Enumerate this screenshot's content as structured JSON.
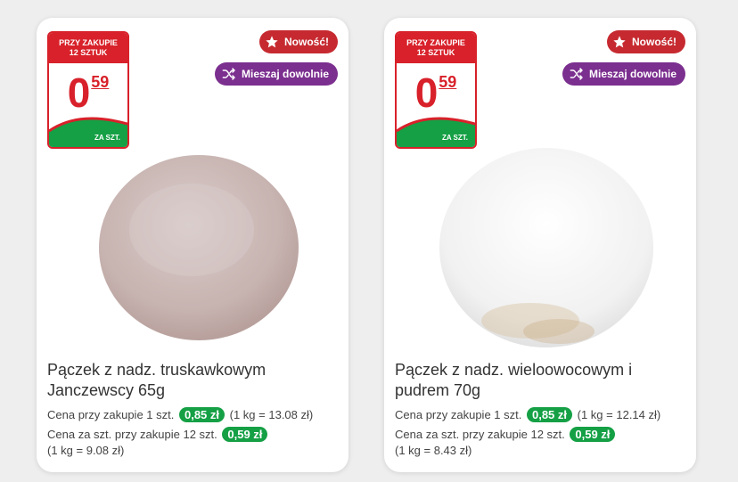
{
  "products": [
    {
      "badge": {
        "line1": "PRZY ZAKUPIE",
        "line2": "12 SZTUK",
        "price_int": "0",
        "price_dec": "59",
        "unit": "ZA SZT."
      },
      "new_label": "Nowość!",
      "mix_label": "Mieszaj dowolnie",
      "title_line1": "Pączek z nadz. truskawkowym",
      "title_line2": "Janczewscy 65g",
      "single_label": "Cena przy zakupie 1 szt.",
      "single_price": "0,85 zł",
      "single_per_kg": "(1 kg = 13.08 zł)",
      "bulk_label": "Cena za szt. przy zakupie 12 szt.",
      "bulk_price": "0,59 zł",
      "bulk_per_kg": "(1 kg = 9.08 zł)",
      "image_icon": "donut-powdered-pink"
    },
    {
      "badge": {
        "line1": "PRZY ZAKUPIE",
        "line2": "12 SZTUK",
        "price_int": "0",
        "price_dec": "59",
        "unit": "ZA SZT."
      },
      "new_label": "Nowość!",
      "mix_label": "Mieszaj dowolnie",
      "title_line1": "Pączek z nadz. wieloowocowym i",
      "title_line2": "pudrem 70g",
      "single_label": "Cena przy zakupie 1 szt.",
      "single_price": "0,85 zł",
      "single_per_kg": "(1 kg = 12.14 zł)",
      "bulk_label": "Cena za szt. przy zakupie 12 szt.",
      "bulk_price": "0,59 zł",
      "bulk_per_kg": "(1 kg = 8.43 zł)",
      "image_icon": "donut-powdered-white"
    }
  ],
  "colors": {
    "badge_red": "#d8212a",
    "badge_green": "#15a045",
    "new_chip": "#c62a30",
    "mix_chip": "#7b2f8f",
    "price_pill": "#15a045"
  }
}
